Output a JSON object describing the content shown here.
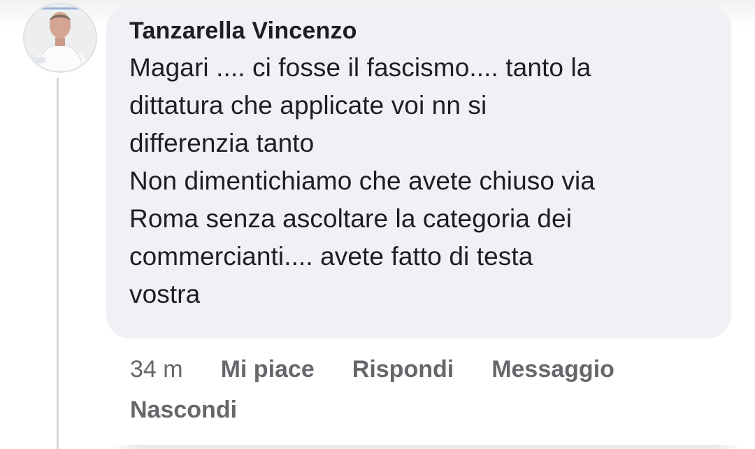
{
  "comment": {
    "author": "Tanzarella Vincenzo",
    "text": "Magari .... ci fosse il fascismo.... tanto la\ndittatura che applicate voi nn si\ndifferenzia tanto\nNon dimentichiamo che avete chiuso via\nRoma senza ascoltare la categoria dei\ncommercianti.... avete fatto di testa\nvostra",
    "time": "34 m",
    "actions": {
      "like": "Mi piace",
      "reply": "Rispondi",
      "message": "Messaggio",
      "hide": "Nascondi"
    }
  },
  "icons": {
    "avatar": "profile-photo"
  },
  "colors": {
    "bubble": "#f0f1f4",
    "text": "#1c1e21",
    "secondary": "#65676b"
  }
}
